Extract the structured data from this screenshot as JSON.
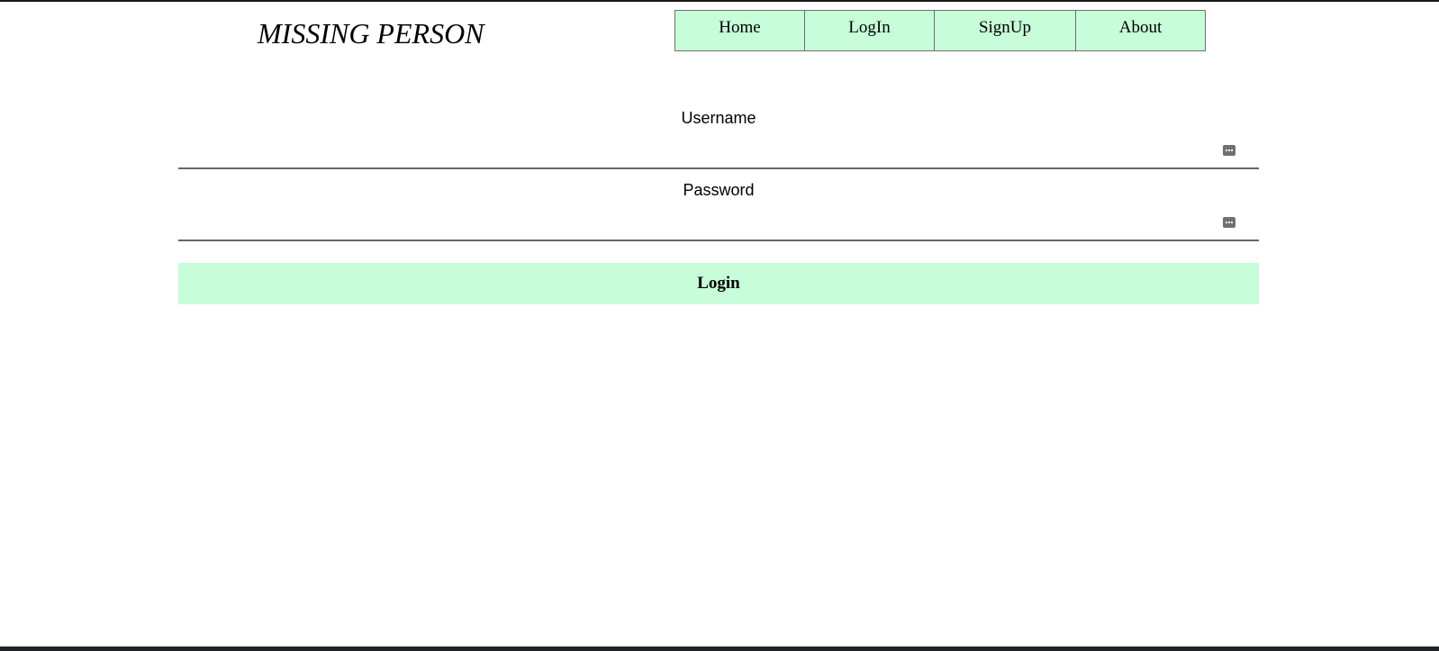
{
  "header": {
    "site_title": "MISSING PERSON"
  },
  "nav": {
    "items": [
      {
        "label": "Home"
      },
      {
        "label": "LogIn"
      },
      {
        "label": "SignUp"
      },
      {
        "label": "About"
      }
    ]
  },
  "form": {
    "username": {
      "label": "Username",
      "value": "",
      "placeholder": ""
    },
    "password": {
      "label": "Password",
      "value": "",
      "placeholder": ""
    },
    "submit_label": "Login"
  },
  "icons": {
    "field_autofill": "password-manager-key-icon"
  },
  "colors": {
    "accent_green": "#c7fdd9",
    "border_gray": "#707070",
    "underline_gray": "#666666",
    "text": "#000000",
    "background": "#ffffff"
  }
}
